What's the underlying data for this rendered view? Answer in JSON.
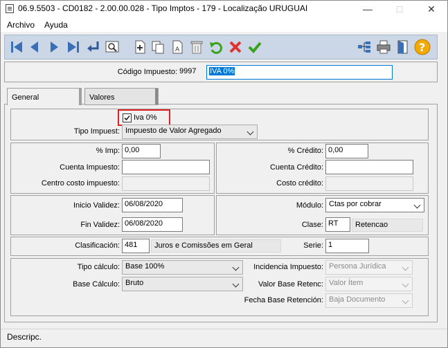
{
  "window": {
    "title": "06.9.5503 - CD0182 - 2.00.00.028 - Tipo Imptos - 179 - Localização URUGUAI"
  },
  "menu": {
    "items": [
      "Archivo",
      "Ayuda"
    ]
  },
  "toolbar": {
    "left_icons": [
      "first-icon",
      "prev-icon",
      "next-icon",
      "last-icon",
      "goto-icon",
      "search-icon",
      "new-icon",
      "copy-icon",
      "edit-icon",
      "delete-icon",
      "undo-icon",
      "cancel-icon",
      "confirm-icon"
    ],
    "right_icons": [
      "tree-icon",
      "print-icon",
      "exit-icon",
      "help-icon"
    ]
  },
  "header": {
    "codigo_label": "Código Impuesto:",
    "codigo_value": "9997",
    "descripcion_value": "IVA 0%"
  },
  "tabs": [
    {
      "label": "General",
      "active": true
    },
    {
      "label": "Valores",
      "active": false
    }
  ],
  "general": {
    "iva_checkbox_label": "Iva 0%",
    "iva_checked": true,
    "tipo_impuesto_label": "Tipo Impuest:",
    "tipo_impuesto_value": "Impuesto de Valor Agregado",
    "pct_imp_label": "% Imp:",
    "pct_imp_value": "0,00",
    "cuenta_impuesto_label": "Cuenta Impuesto:",
    "cuenta_impuesto_value": "",
    "centro_costo_label": "Centro costo impuesto:",
    "centro_costo_value": "",
    "pct_credito_label": "% Crédito:",
    "pct_credito_value": "0,00",
    "cuenta_credito_label": "Cuenta Crédito:",
    "cuenta_credito_value": "",
    "costo_credito_label": "Costo crédito:",
    "costo_credito_value": "",
    "inicio_validez_label": "Inicio Validez:",
    "inicio_validez_value": "06/08/2020",
    "fin_validez_label": "Fin Validez:",
    "fin_validez_value": "06/08/2020",
    "modulo_label": "Módulo:",
    "modulo_value": "Ctas por cobrar",
    "clase_label": "Clase:",
    "clase_code": "RT",
    "clase_desc": "Retencao",
    "clasificacion_label": "Clasificación:",
    "clasificacion_code": "481",
    "clasificacion_desc": "Juros e Comissões em Geral",
    "serie_label": "Serie:",
    "serie_value": "1",
    "tipo_calculo_label": "Tipo cálculo:",
    "tipo_calculo_value": "Base 100%",
    "base_calculo_label": "Base Cálculo:",
    "base_calculo_value": "Bruto",
    "incidencia_label": "Incidencia Impuesto:",
    "incidencia_value": "Persona Jurídica",
    "valor_base_label": "Valor Base Retenc:",
    "valor_base_value": "Valor Ítem",
    "fecha_base_label": "Fecha Base Retención:",
    "fecha_base_value": "Baja Documento"
  },
  "status": {
    "text": "Descripc."
  },
  "colors": {
    "toolbar_bg": "#cbd7e6",
    "selection": "#0078d7",
    "highlight_box": "#e02020"
  }
}
